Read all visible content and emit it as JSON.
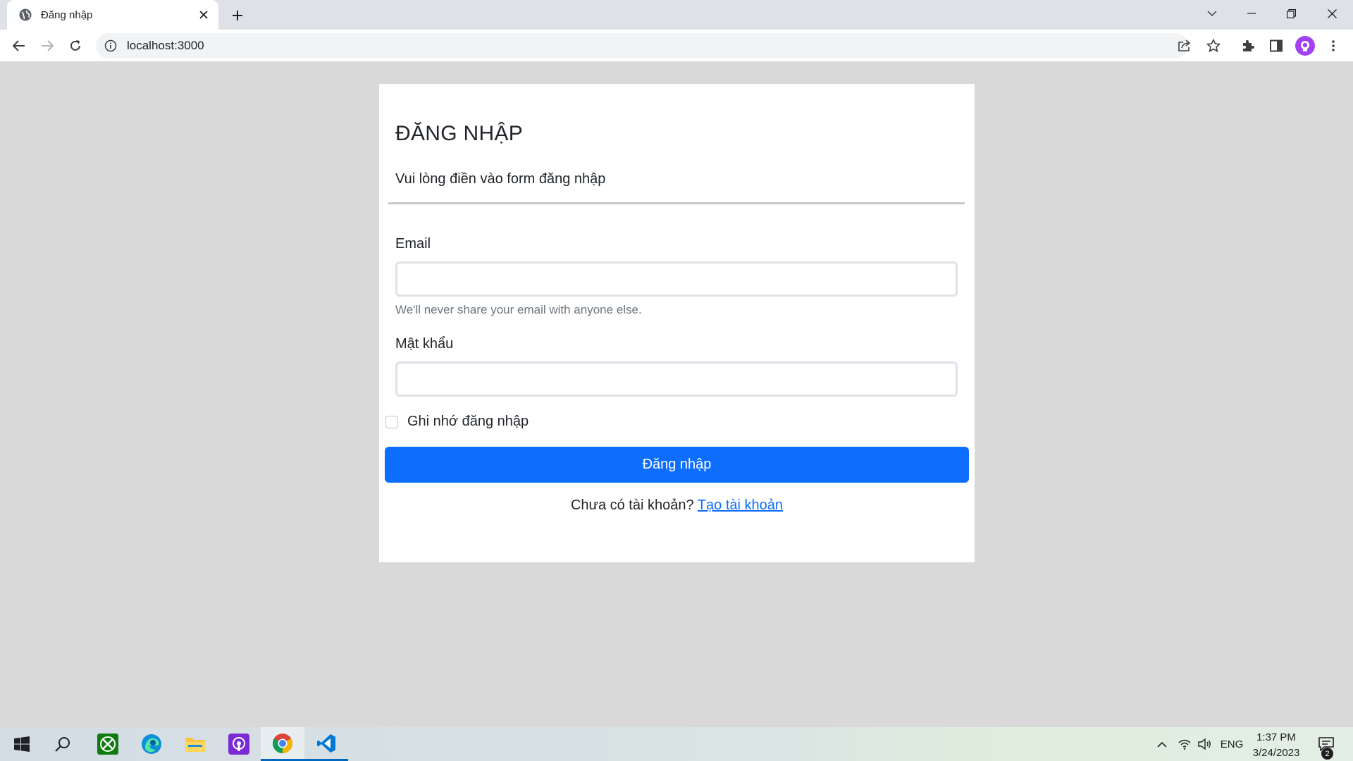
{
  "browser": {
    "tab_title": "Đăng nhập",
    "url": "localhost:3000"
  },
  "page": {
    "heading": "ĐĂNG NHẬP",
    "subtitle": "Vui lòng điền vào form đăng nhập",
    "email_label": "Email",
    "email_value": "",
    "email_help": "We'll never share your email with anyone else.",
    "password_label": "Mật khẩu",
    "password_value": "",
    "remember_label": "Ghi nhớ đăng nhập",
    "remember_checked": false,
    "submit_label": "Đăng nhập",
    "register_prompt": "Chưa có tài khoản?",
    "register_link": "Tạo tài khoản"
  },
  "taskbar": {
    "apps": [
      "start-icon",
      "search-icon",
      "xbox-icon",
      "edge-icon",
      "file-explorer-icon",
      "podcast-app-icon",
      "chrome-icon",
      "vscode-icon"
    ],
    "language": "ENG",
    "time": "1:37 PM",
    "date": "3/24/2023",
    "notification_count": "2"
  },
  "colors": {
    "primary": "#0d6efd",
    "page_background": "#d9d9d9",
    "avatar": "#a142f4"
  }
}
